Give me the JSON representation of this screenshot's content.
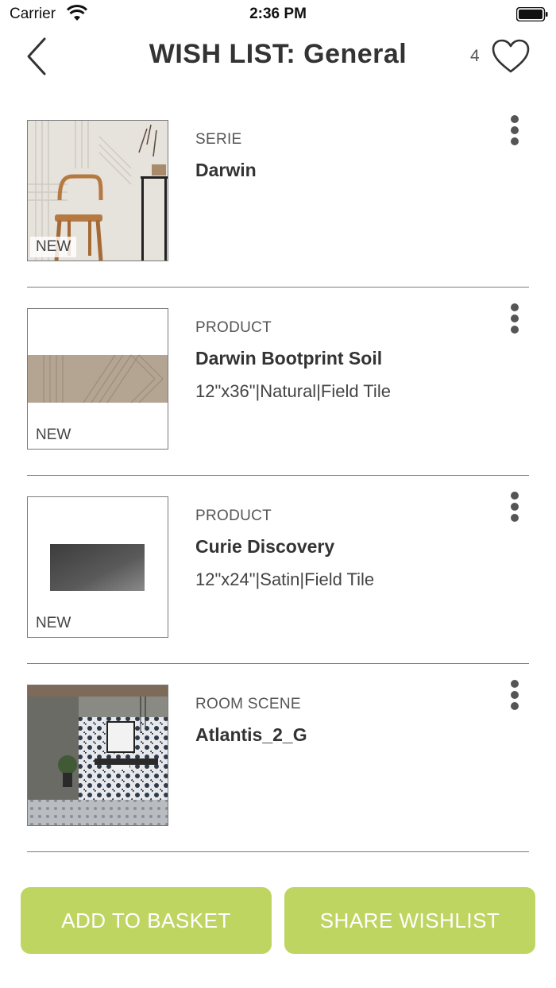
{
  "status_bar": {
    "carrier": "Carrier",
    "time": "2:36 PM",
    "wifi_icon": "wifi-icon",
    "battery_icon": "battery-icon"
  },
  "header": {
    "title": "WISH LIST: General",
    "count": "4",
    "back_icon": "chevron-left-icon",
    "heart_icon": "heart-outline-icon"
  },
  "items": [
    {
      "type": "SERIE",
      "name": "Darwin",
      "spec": "",
      "badge": "NEW"
    },
    {
      "type": "PRODUCT",
      "name": "Darwin Bootprint Soil",
      "spec": "12\"x36\"|Natural|Field Tile",
      "badge": "NEW"
    },
    {
      "type": "PRODUCT",
      "name": "Curie Discovery",
      "spec": "12\"x24\"|Satin|Field Tile",
      "badge": "NEW"
    },
    {
      "type": "ROOM SCENE",
      "name": "Atlantis_2_G",
      "spec": "",
      "badge": ""
    }
  ],
  "buttons": {
    "add_to_basket": "ADD TO BASKET",
    "share_wishlist": "SHARE WISHLIST"
  },
  "colors": {
    "accent_button": "#bed562",
    "divider": "#7a7a7a",
    "text": "#333333"
  }
}
